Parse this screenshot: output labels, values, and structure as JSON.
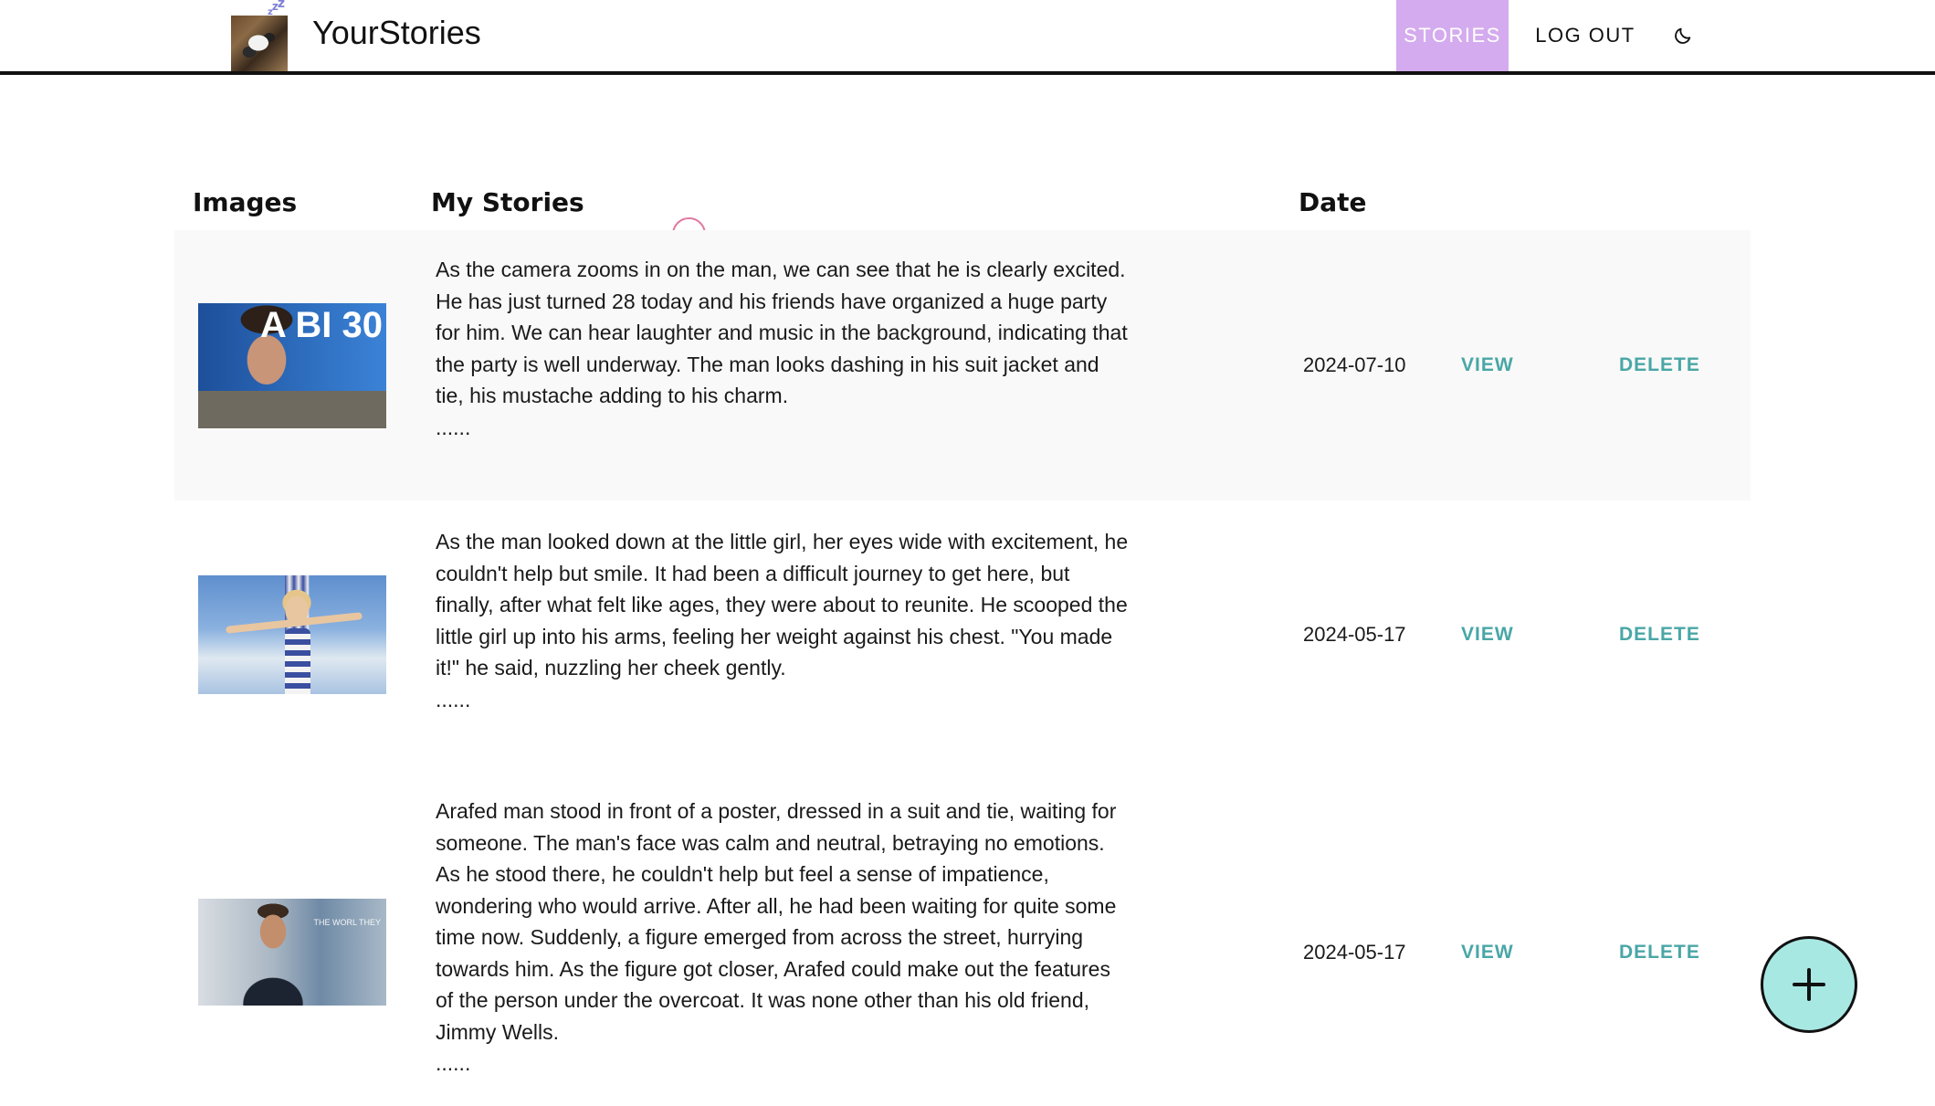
{
  "app": {
    "brand": "YourStories",
    "logo_icon": "sleeping-cat-avatar",
    "logo_badge": "zzz"
  },
  "nav": {
    "stories": "STORIES",
    "logout": "LOG OUT",
    "theme_icon": "moon-icon",
    "active_color": "#d4abee"
  },
  "table": {
    "headers": {
      "images": "Images",
      "stories": "My Stories",
      "date": "Date"
    },
    "rows": [
      {
        "image_icon": "portrait-man-smiling",
        "image_text": "A BI 30",
        "story": "As the camera zooms in on the man, we can see that he is clearly excited. He has just turned 28 today and his friends have organized a huge party for him. We can hear laughter and music in the background, indicating that the party is well underway. The man looks dashing in his suit jacket and tie, his mustache adding to his charm.",
        "more": "......",
        "date": "2024-07-10",
        "view": "VIEW",
        "delete": "DELETE"
      },
      {
        "image_icon": "girl-arms-outstretched-sky",
        "story": "As the man looked down at the little girl, her eyes wide with excitement, he couldn't help but smile. It had been a difficult journey to get here, but finally, after what felt like ages, they were about to reunite. He scooped the little girl up into his arms, feeling her weight against his chest. \"You made it!\" he said, nuzzling her cheek gently.",
        "more": "......",
        "date": "2024-05-17",
        "view": "VIEW",
        "delete": "DELETE"
      },
      {
        "image_icon": "portrait-man-poster",
        "image_text": "THE WORL THEY",
        "story": "Arafed man stood in front of a poster, dressed in a suit and tie, waiting for someone. The man's face was calm and neutral, betraying no emotions. As he stood there, he couldn't help but feel a sense of impatience, wondering who would arrive. After all, he had been waiting for quite some time now. Suddenly, a figure emerged from across the street, hurrying towards him. As the figure got closer, Arafed could make out the features of the person under the overcoat. It was none other than his old friend, Jimmy Wells.",
        "more": "......",
        "date": "2024-05-17",
        "view": "VIEW",
        "delete": "DELETE"
      }
    ]
  },
  "colors": {
    "link": "#4aa6a6",
    "fab": "#a8e8e3",
    "row_shade": "#f8f9f8"
  },
  "fab": {
    "icon": "plus-icon"
  }
}
